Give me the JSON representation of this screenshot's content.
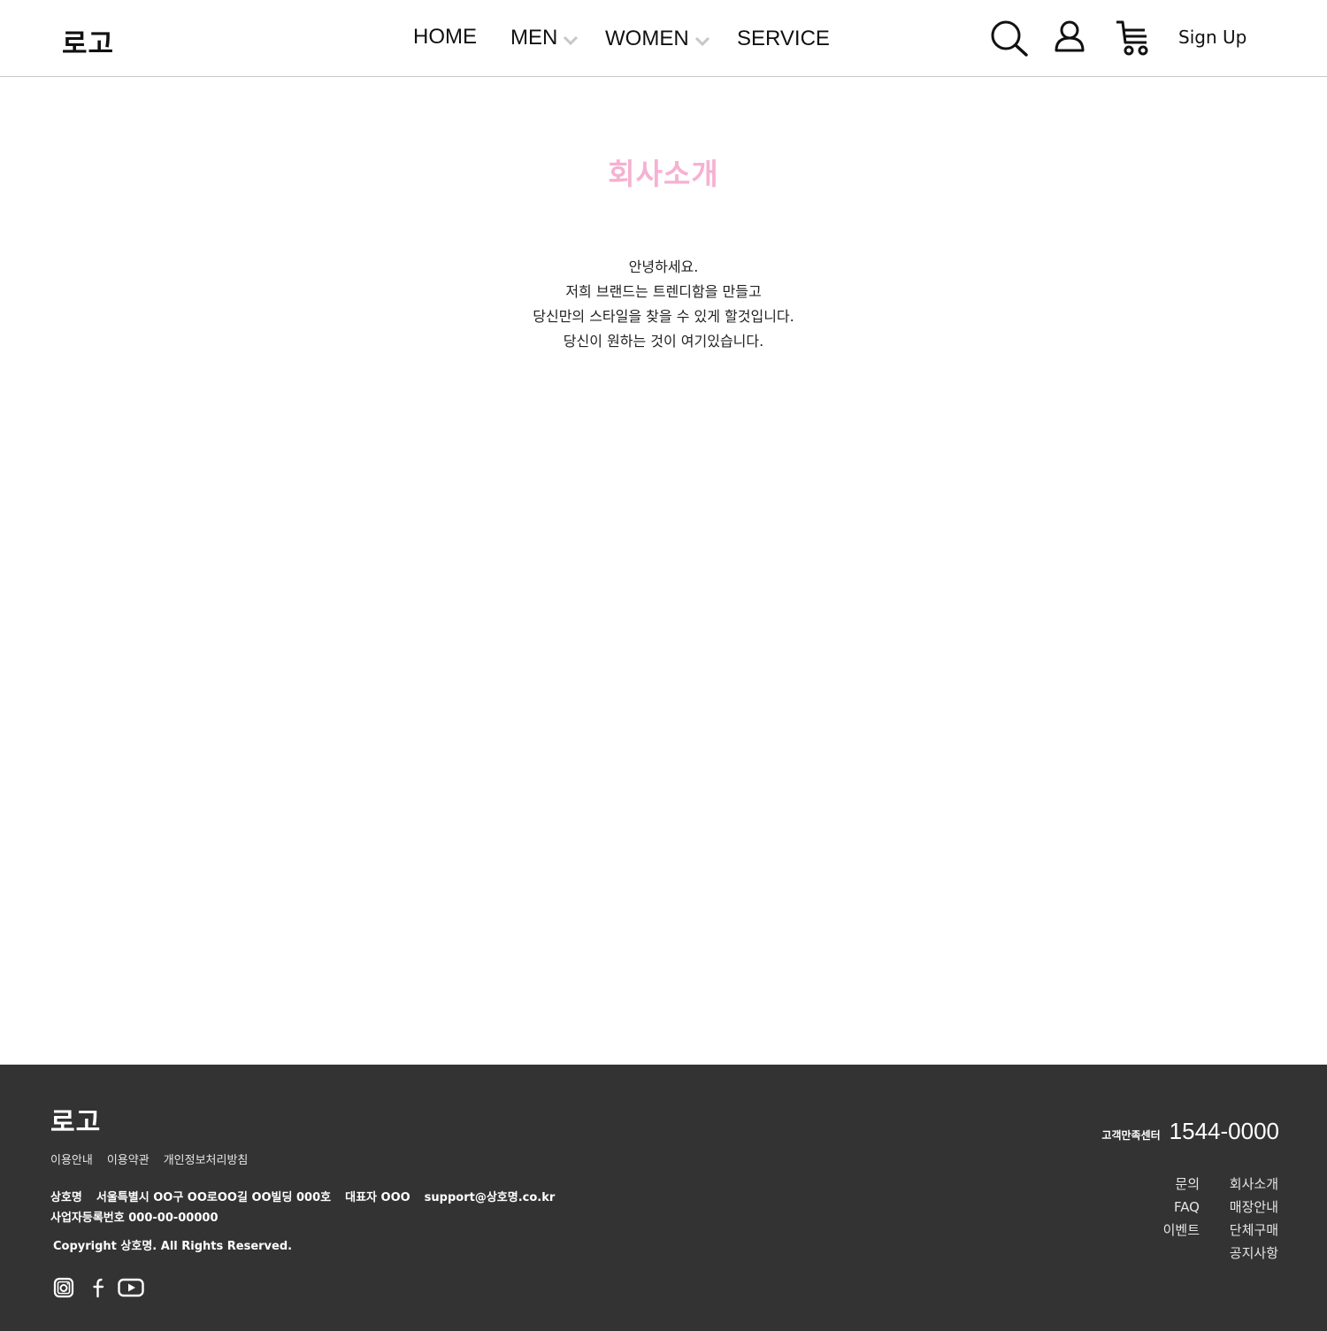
{
  "header": {
    "logo": "로고",
    "nav": {
      "home": "HOME",
      "men": "MEN",
      "women": "WOMEN",
      "service": "SERVICE"
    },
    "icons": [
      "search-icon",
      "user-icon",
      "cart-icon"
    ],
    "signup": "Sign Up"
  },
  "main": {
    "title": "회사소개",
    "title_color": "#f6b1d2",
    "intro": [
      "안녕하세요.",
      "저희 브랜드는 트렌디함을 만들고",
      "당신만의 스타일을 찾을 수 있게 할것입니다.",
      "당신이 원하는 것이 여기있습니다."
    ]
  },
  "footer": {
    "background": "#333333",
    "logo": "로고",
    "links": [
      "이용안내",
      "이용약관",
      "개인정보처리방침"
    ],
    "info": {
      "company": "상호명",
      "address": "서울특별시 OO구 OO로OO길 OO빌딩 000호",
      "ceo": "대표자 OOO",
      "email": "support@상호명.co.kr",
      "biz_number": "사업자등록번호 000-00-00000"
    },
    "copyright": "Copyright 상호명. All Rights Reserved.",
    "social": [
      "instagram-icon",
      "facebook-icon",
      "youtube-icon"
    ],
    "cs_label": "고객만족센터",
    "cs_phone": "1544-0000",
    "menu_left": [
      "문의",
      "FAQ",
      "이벤트"
    ],
    "menu_right": [
      "회사소개",
      "매장안내",
      "단체구매",
      "공지사항"
    ]
  }
}
